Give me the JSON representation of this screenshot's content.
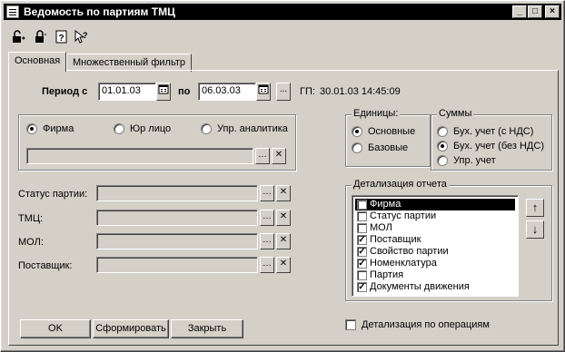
{
  "window": {
    "title": "Ведомость по партиям ТМЦ",
    "controls": [
      "_",
      "□",
      "×"
    ]
  },
  "toolbar": {
    "icons": [
      "lock-open-icon",
      "lock-icon",
      "help-icon",
      "whats-this-icon"
    ]
  },
  "tabs": [
    {
      "label": "Основная",
      "active": true
    },
    {
      "label": "Множественный фильтр",
      "active": false
    }
  ],
  "period": {
    "label": "Период с",
    "from": "01.01.03",
    "to_label": "по",
    "to": "06.03.03",
    "more": "...",
    "gp_label": "ГП:",
    "gp_value": "30.01.03 14:45:09"
  },
  "entity": {
    "options": [
      {
        "label": "Фирма",
        "selected": true
      },
      {
        "label": "Юр лицо",
        "selected": false
      },
      {
        "label": "Упр. аналитика",
        "selected": false
      }
    ],
    "value": ""
  },
  "filters": [
    {
      "label": "Статус партии:",
      "value": ""
    },
    {
      "label": "ТМЦ:",
      "value": ""
    },
    {
      "label": "МОЛ:",
      "value": ""
    },
    {
      "label": "Поставщик:",
      "value": ""
    }
  ],
  "units": {
    "title": "Единицы:",
    "options": [
      {
        "label": "Основные",
        "selected": true
      },
      {
        "label": "Базовые",
        "selected": false
      }
    ]
  },
  "sums": {
    "title": "Суммы",
    "options": [
      {
        "label": "Бух. учет (с НДС)",
        "selected": false
      },
      {
        "label": "Бух. учет (без НДС)",
        "selected": true
      },
      {
        "label": "Упр. учет",
        "selected": false
      }
    ]
  },
  "detail": {
    "title": "Детализация отчета",
    "items": [
      {
        "label": "Фирма",
        "checked": false,
        "selected": true
      },
      {
        "label": "Статус партии",
        "checked": false,
        "selected": false
      },
      {
        "label": "МОЛ",
        "checked": false,
        "selected": false
      },
      {
        "label": "Поставщик",
        "checked": true,
        "selected": false
      },
      {
        "label": "Свойство партии",
        "checked": true,
        "selected": false
      },
      {
        "label": "Номенклатура",
        "checked": true,
        "selected": false
      },
      {
        "label": "Партия",
        "checked": false,
        "selected": false
      },
      {
        "label": "Документы движения",
        "checked": true,
        "selected": false
      }
    ],
    "up": "↑",
    "down": "↓"
  },
  "detail_by_ops": {
    "label": "Детализация по операциям",
    "checked": false
  },
  "buttons": {
    "ok": "OK",
    "generate": "Сформировать",
    "close": "Закрыть"
  }
}
